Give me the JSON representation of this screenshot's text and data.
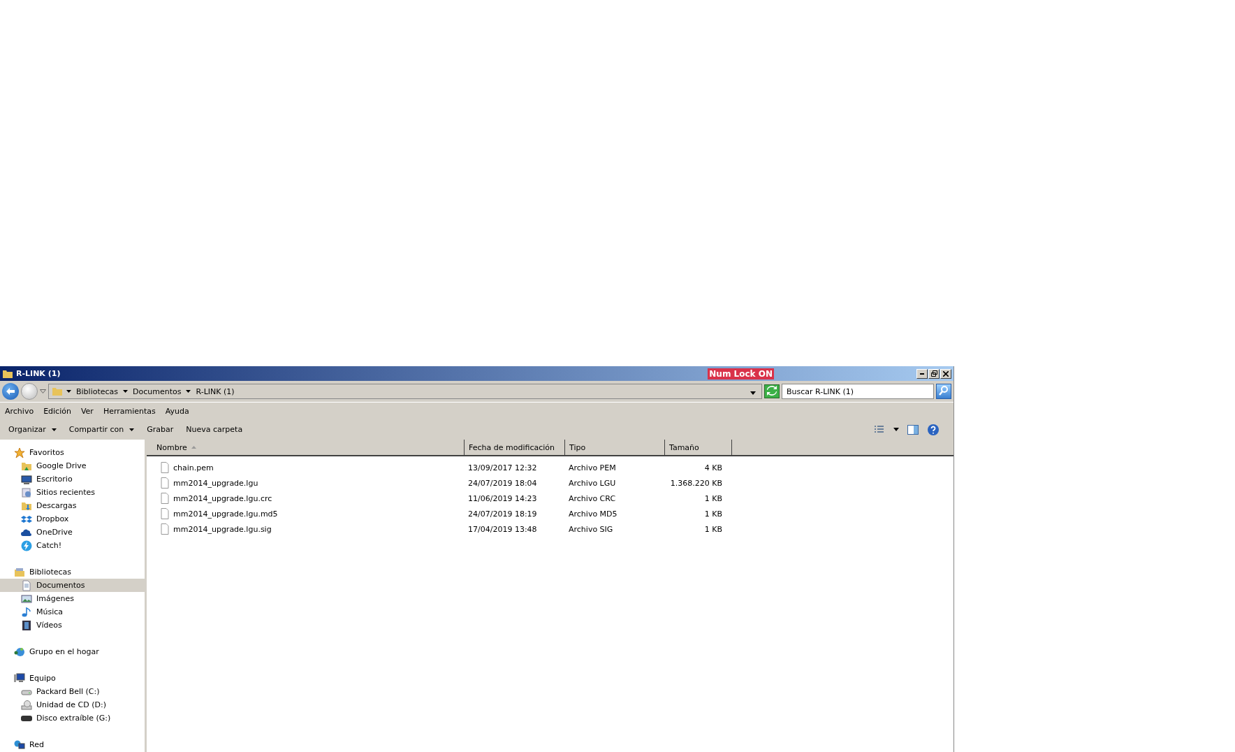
{
  "window": {
    "title": "R-LINK (1)",
    "badge": "Num Lock ON"
  },
  "address": {
    "crumbs": [
      "Bibliotecas",
      "Documentos",
      "R-LINK (1)"
    ]
  },
  "search": {
    "placeholder": "Buscar R-LINK (1)"
  },
  "menu": [
    "Archivo",
    "Edición",
    "Ver",
    "Herramientas",
    "Ayuda"
  ],
  "commands": [
    {
      "label": "Organizar",
      "has_menu": true
    },
    {
      "label": "Compartir con",
      "has_menu": true
    },
    {
      "label": "Grabar",
      "has_menu": false
    },
    {
      "label": "Nueva carpeta",
      "has_menu": false
    }
  ],
  "sidebar": [
    {
      "label": "Favoritos",
      "kind": "star",
      "selected": false,
      "children": [
        {
          "label": "Google Drive",
          "kind": "gdrive",
          "selected": false
        },
        {
          "label": "Escritorio",
          "kind": "desktop",
          "selected": false
        },
        {
          "label": "Sitios recientes",
          "kind": "recent",
          "selected": false
        },
        {
          "label": "Descargas",
          "kind": "download",
          "selected": false
        },
        {
          "label": "Dropbox",
          "kind": "dropbox",
          "selected": false
        },
        {
          "label": "OneDrive",
          "kind": "cloud",
          "selected": false
        },
        {
          "label": "Catch!",
          "kind": "bolt",
          "selected": false
        }
      ]
    },
    {
      "label": "Bibliotecas",
      "kind": "library",
      "selected": false,
      "children": [
        {
          "label": "Documentos",
          "kind": "document",
          "selected": true
        },
        {
          "label": "Imágenes",
          "kind": "image",
          "selected": false
        },
        {
          "label": "Música",
          "kind": "music",
          "selected": false
        },
        {
          "label": "Vídeos",
          "kind": "video",
          "selected": false
        }
      ]
    },
    {
      "label": "Grupo en el hogar",
      "kind": "homegroup",
      "selected": false
    },
    {
      "label": "Equipo",
      "kind": "computer",
      "selected": false,
      "children": [
        {
          "label": "Packard Bell (C:)",
          "kind": "harddisk",
          "selected": false
        },
        {
          "label": "Unidad de CD (D:)",
          "kind": "cd",
          "selected": false
        },
        {
          "label": "Disco extraíble (G:)",
          "kind": "removable",
          "selected": false
        }
      ]
    },
    {
      "label": "Red",
      "kind": "network",
      "selected": false
    }
  ],
  "table": {
    "columns": [
      {
        "label": "Nombre",
        "sorted": true
      },
      {
        "label": "Fecha de modificación",
        "sorted": false
      },
      {
        "label": "Tipo",
        "sorted": false
      },
      {
        "label": "Tamaño",
        "sorted": false
      }
    ],
    "rows": [
      {
        "name": "chain.pem",
        "date": "13/09/2017 12:32",
        "type": "Archivo PEM",
        "size": "4 KB"
      },
      {
        "name": "mm2014_upgrade.lgu",
        "date": "24/07/2019 18:04",
        "type": "Archivo LGU",
        "size": "1.368.220 KB"
      },
      {
        "name": "mm2014_upgrade.lgu.crc",
        "date": "11/06/2019 14:23",
        "type": "Archivo CRC",
        "size": "1 KB"
      },
      {
        "name": "mm2014_upgrade.lgu.md5",
        "date": "24/07/2019 18:19",
        "type": "Archivo MD5",
        "size": "1 KB"
      },
      {
        "name": "mm2014_upgrade.lgu.sig",
        "date": "17/04/2019 13:48",
        "type": "Archivo SIG",
        "size": "1 KB"
      }
    ]
  }
}
